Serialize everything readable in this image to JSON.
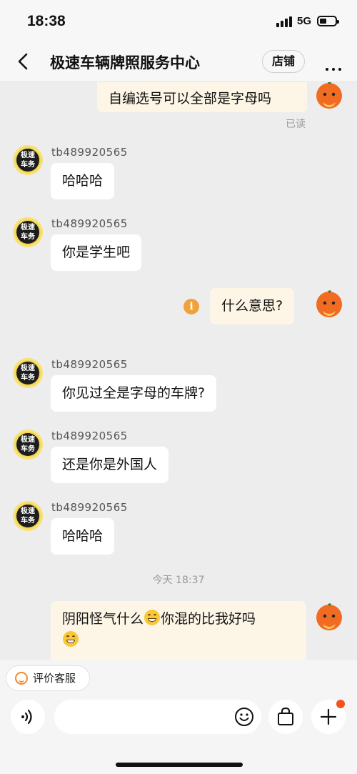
{
  "status_bar": {
    "time": "18:38",
    "network": "5G"
  },
  "nav": {
    "title": "极速车辆牌照服务中心",
    "shop_button": "店铺"
  },
  "shop_avatar_text": {
    "line1": "极速",
    "line2": "车务"
  },
  "messages": [
    {
      "from": "me",
      "text": "自编选号可以全部是字母吗"
    },
    {
      "from": "shop",
      "sender": "tb489920565",
      "text": "哈哈哈"
    },
    {
      "from": "shop",
      "sender": "tb489920565",
      "text": "你是学生吧"
    },
    {
      "from": "me",
      "text": "什么意思?"
    },
    {
      "from": "shop",
      "sender": "tb489920565",
      "text": "你见过全是字母的车牌?"
    },
    {
      "from": "shop",
      "sender": "tb489920565",
      "text": "还是你是外国人"
    },
    {
      "from": "shop",
      "sender": "tb489920565",
      "text": "哈哈哈"
    },
    {
      "from": "me",
      "text_parts": [
        "阴阳怪气什么",
        "你混的比我好吗"
      ]
    }
  ],
  "read_status": "已读",
  "timestamp": "今天 18:37",
  "bottom": {
    "rate_button": "评价客服"
  },
  "colors": {
    "accent": "#f08a2d",
    "my_bubble": "#fdf6e6",
    "badge": "#f4511e"
  },
  "icons": [
    "back-arrow-icon",
    "more-dots-icon",
    "info-icon",
    "voice-icon",
    "emoji-icon",
    "shopping-bag-icon",
    "plus-icon",
    "smile-rate-icon"
  ]
}
